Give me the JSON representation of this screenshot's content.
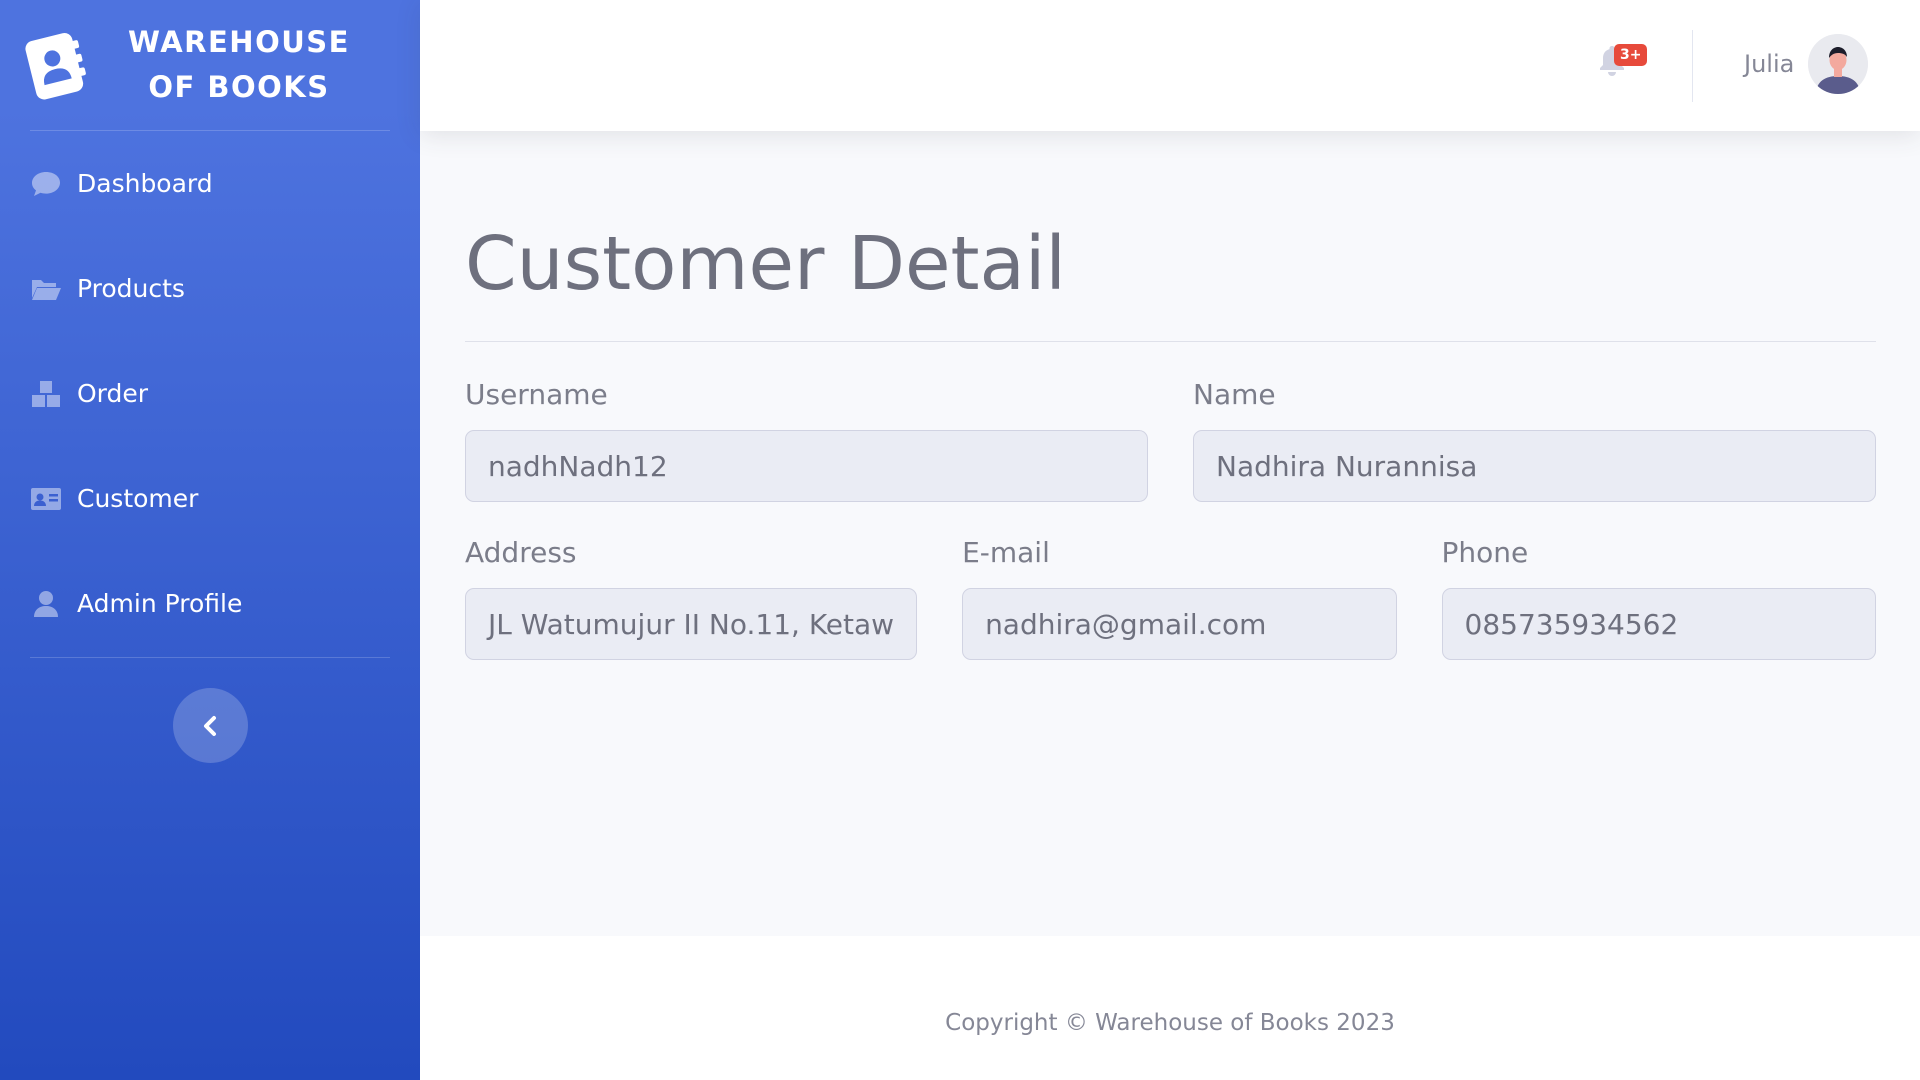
{
  "brand": {
    "line1": "WAREHOUSE",
    "line2": "OF BOOKS",
    "icon": "address-book-icon"
  },
  "sidebar": {
    "items": [
      {
        "label": "Dashboard",
        "icon": "comment-icon"
      },
      {
        "label": "Products",
        "icon": "folder-open-icon"
      },
      {
        "label": "Order",
        "icon": "boxes-icon"
      },
      {
        "label": "Customer",
        "icon": "id-card-icon"
      },
      {
        "label": "Admin Profile",
        "icon": "user-icon"
      }
    ],
    "toggle_icon": "chevron-left-icon"
  },
  "topbar": {
    "notification_badge": "3+",
    "user_name": "Julia"
  },
  "page": {
    "title": "Customer Detail"
  },
  "form": {
    "username": {
      "label": "Username",
      "value": "nadhNadh12"
    },
    "name": {
      "label": "Name",
      "value": "Nadhira Nurannisa"
    },
    "address": {
      "label": "Address",
      "value": "JL Watumujur II No.11, Ketaw"
    },
    "email": {
      "label": "E-mail",
      "value": "nadhira@gmail.com"
    },
    "phone": {
      "label": "Phone",
      "value": "085735934562"
    }
  },
  "footer": {
    "text": "Copyright © Warehouse of Books 2023"
  },
  "colors": {
    "sidebar_top": "#4e73df",
    "sidebar_bottom": "#224abe",
    "badge": "#e74a3b",
    "content_bg": "#f8f9fc"
  }
}
